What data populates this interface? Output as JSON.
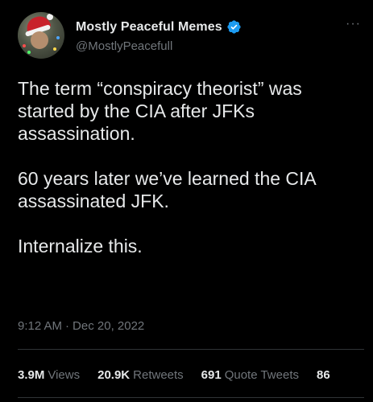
{
  "author": {
    "display_name": "Mostly Peaceful Memes",
    "handle": "@MostlyPeacefull",
    "verified": true,
    "verified_color": "#1d9bf0",
    "avatar_icon": "santa-hat-avatar"
  },
  "more_icon": "···",
  "tweet": {
    "paragraphs": [
      "The term “conspiracy theorist” was started by the CIA after JFKs assassination.",
      "60 years later we’ve learned the CIA assassinated JFK.",
      "Internalize this."
    ],
    "time": "9:12 AM",
    "separator": "·",
    "date": "Dec 20, 2022"
  },
  "stats": {
    "views_count": "3.9M",
    "views_label": "Views",
    "retweets_count": "20.9K",
    "retweets_label": "Retweets",
    "quotes_count": "691",
    "quotes_label": "Quote Tweets",
    "likes_count_partial": "86"
  },
  "colors": {
    "background": "#000000",
    "primary_text": "#e7e9ea",
    "secondary_text": "#71767b",
    "divider": "#2f3336"
  }
}
